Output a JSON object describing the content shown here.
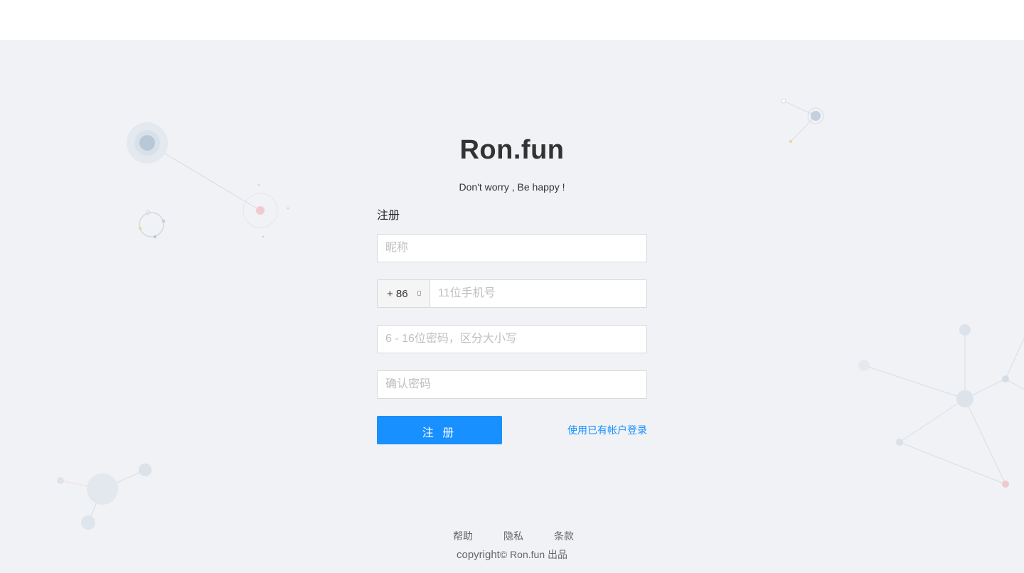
{
  "header": {},
  "brand": {
    "title": "Ron.fun",
    "slogan": "Don't worry , Be happy !"
  },
  "form": {
    "title": "注册",
    "nickname_placeholder": "昵称",
    "phone_prefix": "+ 86",
    "phone_placeholder": "11位手机号",
    "password_placeholder": "6 - 16位密码，区分大小写",
    "confirm_placeholder": "确认密码",
    "register_label": "注 册",
    "login_link": "使用已有帐户登录"
  },
  "footer": {
    "links": [
      "帮助",
      "隐私",
      "条款"
    ],
    "copyright_prefix": "copyright",
    "copyright_suffix": "© Ron.fun 出品"
  },
  "colors": {
    "primary": "#1890ff",
    "background": "#f0f2f5",
    "text": "#333333"
  }
}
